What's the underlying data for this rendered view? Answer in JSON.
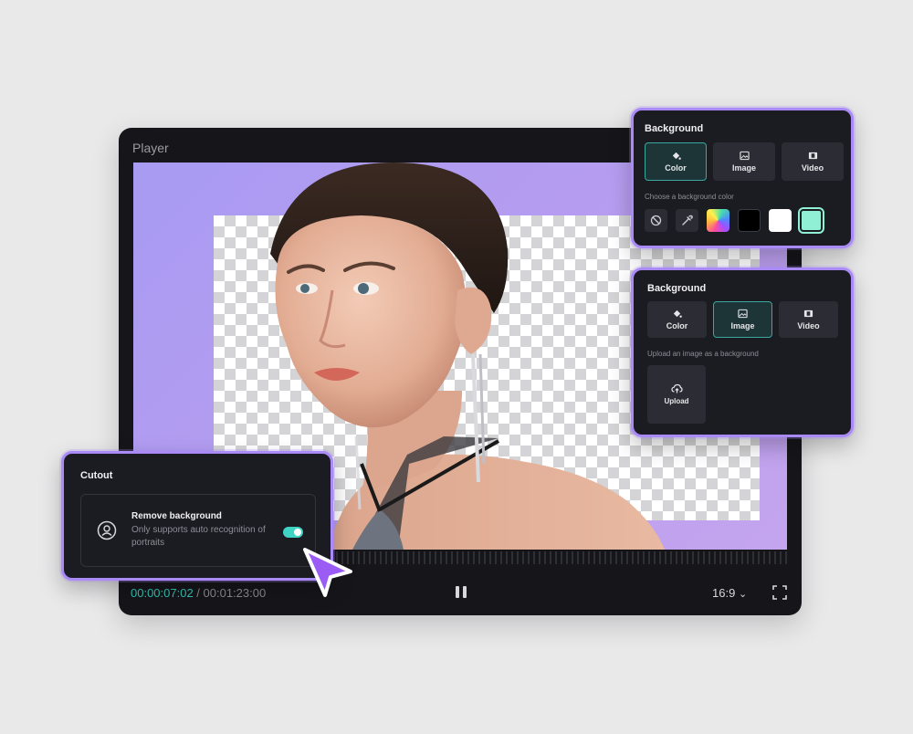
{
  "player": {
    "title": "Player",
    "time_current": "00:00:07:02",
    "time_separator": " / ",
    "time_total": "00:01:23:00",
    "aspect_ratio": "16:9",
    "aspect_chevron": "⌄"
  },
  "bg_color_panel": {
    "title": "Background",
    "tabs": [
      {
        "label": "Color",
        "icon": "paint-bucket-icon",
        "active": true
      },
      {
        "label": "Image",
        "icon": "image-icon",
        "active": false
      },
      {
        "label": "Video",
        "icon": "video-icon",
        "active": false
      }
    ],
    "hint": "Choose a background color",
    "swatches": [
      "none",
      "eyedropper",
      "gradient",
      "#000000",
      "#ffffff",
      "#8ff0d6"
    ]
  },
  "bg_image_panel": {
    "title": "Background",
    "tabs": [
      {
        "label": "Color",
        "icon": "paint-bucket-icon",
        "active": false
      },
      {
        "label": "Image",
        "icon": "image-icon",
        "active": true
      },
      {
        "label": "Video",
        "icon": "video-icon",
        "active": false
      }
    ],
    "hint": "Upload an image as a background",
    "upload_label": "Upload"
  },
  "cutout_panel": {
    "title": "Cutout",
    "option_title": "Remove background",
    "option_desc": "Only supports auto recognition of portraits",
    "toggle_on": true
  },
  "colors": {
    "accent_purple": "#a98af6",
    "accent_teal": "#3fd3c3",
    "panel_bg": "#1b1b22"
  }
}
